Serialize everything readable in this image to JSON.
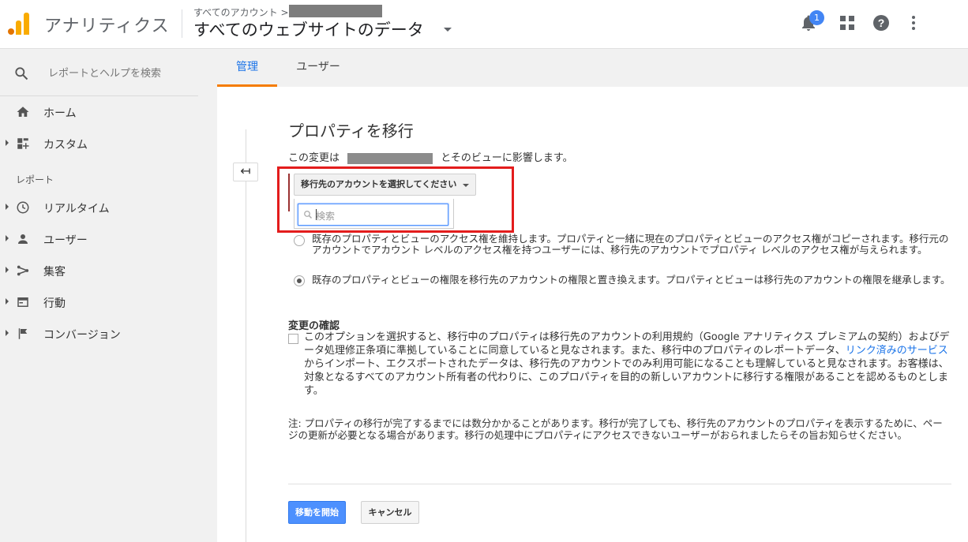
{
  "header": {
    "app_name": "アナリティクス",
    "breadcrumb": "すべてのアカウント >",
    "property_title": "すべてのウェブサイトのデータ",
    "notification_count": "1"
  },
  "sidebar": {
    "search_placeholder": "レポートとヘルプを検索",
    "items_top": [
      {
        "label": "ホーム",
        "icon": "home-icon"
      },
      {
        "label": "カスタム",
        "icon": "dashboard-icon"
      }
    ],
    "section_label": "レポート",
    "items_reports": [
      {
        "label": "リアルタイム",
        "icon": "clock-icon"
      },
      {
        "label": "ユーザー",
        "icon": "person-icon"
      },
      {
        "label": "集客",
        "icon": "acquisition-icon"
      },
      {
        "label": "行動",
        "icon": "behavior-icon"
      },
      {
        "label": "コンバージョン",
        "icon": "flag-icon"
      }
    ]
  },
  "tabs": {
    "admin": "管理",
    "user": "ユーザー"
  },
  "main": {
    "title": "プロパティを移行",
    "affects_prefix": "この変更は",
    "affects_suffix": "とそのビューに影響します。",
    "account_select_label": "移行先のアカウントを選択してください",
    "search_placeholder": "検索",
    "option1": "既存のプロパティとビューのアクセス権を維持します。プロパティと一緒に現在のプロパティとビューのアクセス権がコピーされます。移行元のアカウントでアカウント レベルのアクセス権を持つユーザーには、移行先のアカウントでプロパティ レベルのアクセス権が与えられます。",
    "option2": "既存のプロパティとビューの権限を移行先のアカウントの権限と置き換えます。プロパティとビューは移行先のアカウントの権限を継承します。",
    "confirm_heading": "変更の確認",
    "confirm_text_1": "このオプションを選択すると、移行中のプロパティは移行先のアカウントの利用規約（Google アナリティクス プレミアムの契約）およびデータ処理修正条項に準拠していることに同意していると見なされます。また、移行中のプロパティのレポートデータ、",
    "confirm_link": "リンク済みのサービス",
    "confirm_text_2": "からインポート、エクスポートされたデータは、移行先のアカウントでのみ利用可能になることも理解していると見なされます。お客様は、対象となるすべてのアカウント所有者の代わりに、このプロパティを目的の新しいアカウントに移行する権限があることを認めるものとします。",
    "note": "注: プロパティの移行が完了するまでには数分かかることがあります。移行が完了しても、移行先のアカウントのプロパティを表示するために、ページの更新が必要となる場合があります。移行の処理中にプロパティにアクセスできないユーザーがおられましたらその旨お知らせください。",
    "start_button": "移動を開始",
    "cancel_button": "キャンセル",
    "back_glyph": "↤"
  },
  "colors": {
    "accent_blue": "#1a73e8",
    "tab_underline": "#f57c00",
    "highlight_red": "#e31c1c",
    "primary_button": "#4d90fe"
  }
}
